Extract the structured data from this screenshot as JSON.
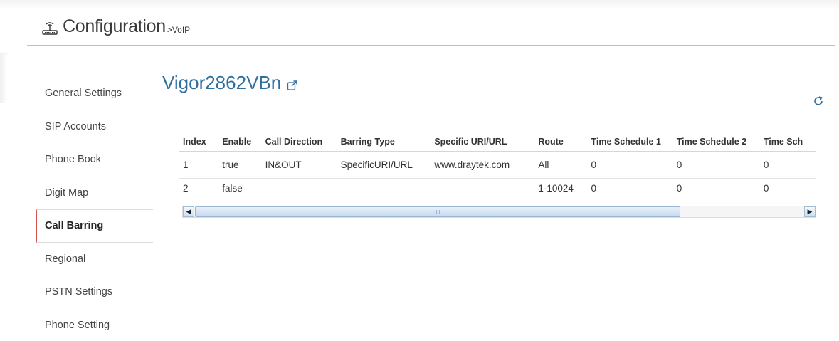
{
  "header": {
    "title": "Configuration",
    "breadcrumb": ">VoIP",
    "icon": "router-icon"
  },
  "sidebar": {
    "items": [
      {
        "label": "General Settings"
      },
      {
        "label": "SIP Accounts"
      },
      {
        "label": "Phone Book"
      },
      {
        "label": "Digit Map"
      },
      {
        "label": "Call Barring",
        "active": true
      },
      {
        "label": "Regional"
      },
      {
        "label": "PSTN Settings"
      },
      {
        "label": "Phone Setting"
      }
    ]
  },
  "main": {
    "device_name": "Vigor2862VBn",
    "table": {
      "columns": [
        "Index",
        "Enable",
        "Call Direction",
        "Barring Type",
        "Specific URI/URL",
        "Route",
        "Time Schedule 1",
        "Time Schedule 2",
        "Time Sch"
      ],
      "rows": [
        [
          "1",
          "true",
          "IN&OUT",
          "SpecificURI/URL",
          "www.draytek.com",
          "All",
          "0",
          "0",
          "0"
        ],
        [
          "2",
          "false",
          "",
          "",
          "",
          "1-10024",
          "0",
          "0",
          "0"
        ]
      ]
    }
  },
  "colors": {
    "accent": "#2f6f9f",
    "active_marker": "#d9534f"
  }
}
